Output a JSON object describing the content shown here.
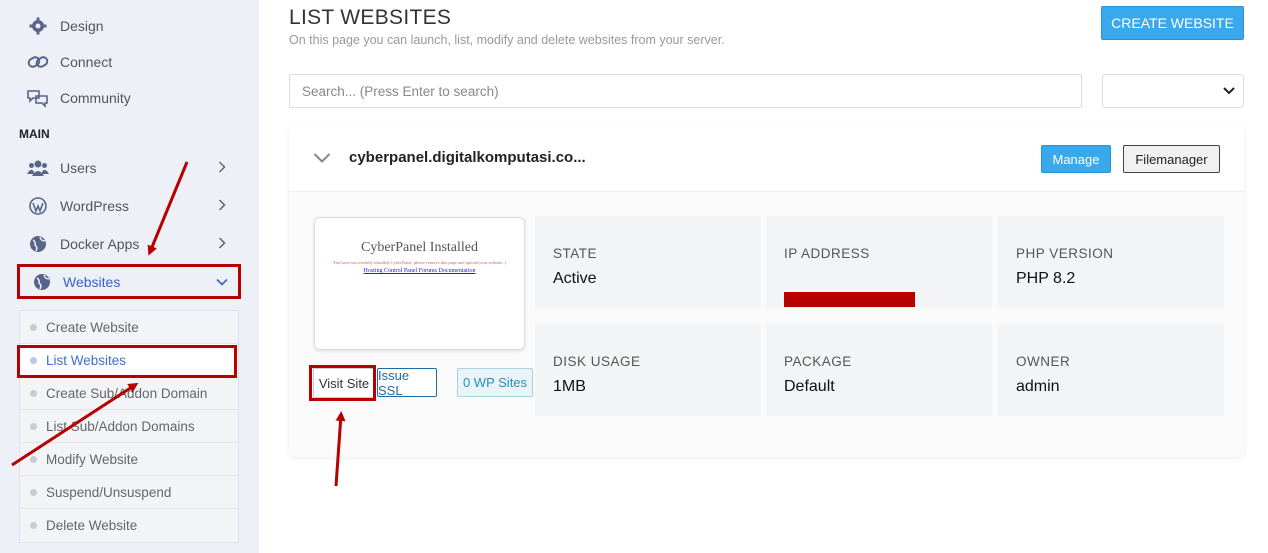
{
  "sidebar": {
    "top_items": [
      {
        "label": "Design",
        "icon": "gear-icon"
      },
      {
        "label": "Connect",
        "icon": "link-icon"
      },
      {
        "label": "Community",
        "icon": "chat-icon"
      }
    ],
    "section_label": "MAIN",
    "main_items": [
      {
        "label": "Users",
        "icon": "users-icon"
      },
      {
        "label": "WordPress",
        "icon": "wordpress-icon"
      },
      {
        "label": "Docker Apps",
        "icon": "globe-icon"
      },
      {
        "label": "Websites",
        "icon": "globe-icon"
      }
    ],
    "websites_submenu": [
      "Create Website",
      "List Websites",
      "Create Sub/Addon Domain",
      "List Sub/Addon Domains",
      "Modify Website",
      "Suspend/Unsuspend",
      "Delete Website"
    ]
  },
  "header": {
    "title": "LIST WEBSITES",
    "subtitle": "On this page you can launch, list, modify and delete websites from your server.",
    "create_button": "CREATE WEBSITE"
  },
  "search": {
    "placeholder": "Search... (Press Enter to search)",
    "select_value": ""
  },
  "website": {
    "domain": "cyberpanel.digitalkomputasi.co...",
    "manage_label": "Manage",
    "filemanager_label": "Filemanager",
    "thumbnail": {
      "title": "CyberPanel Installed",
      "text": "You have successfully installed CyberPanel, please remove this page and upload your website :)",
      "links": "Hosting Control Panel Forums Documentation"
    },
    "visit_label": "Visit Site",
    "ssl_label": "Issue SSL",
    "wp_label": "0 WP Sites",
    "stats": {
      "state_label": "STATE",
      "state_value": "Active",
      "ip_label": "IP ADDRESS",
      "php_label": "PHP VERSION",
      "php_value": "PHP 8.2",
      "disk_label": "DISK USAGE",
      "disk_value": "1MB",
      "package_label": "PACKAGE",
      "package_value": "Default",
      "owner_label": "OWNER",
      "owner_value": "admin"
    }
  },
  "colors": {
    "accent": "#3aa8ec",
    "highlight": "#b70000",
    "sidebar_bg": "#eef0f7",
    "active_link": "#3d6fd1"
  }
}
